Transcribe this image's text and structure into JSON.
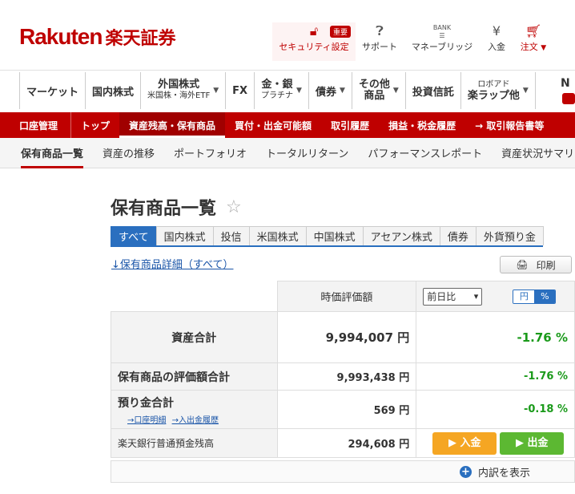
{
  "brand": {
    "logo_en": "Rakuten",
    "logo_jp": "楽天証券",
    "color": "#bf0000"
  },
  "header": {
    "security": {
      "label": "セキュリティ設定",
      "badge": "重要",
      "icon": "lock-icon"
    },
    "support": {
      "label": "サポート",
      "icon": "support-icon"
    },
    "money_bridge": {
      "label": "マネーブリッジ",
      "icon": "bank-icon",
      "icon_text": "BANK"
    },
    "deposit": {
      "label": "入金",
      "icon": "yen-icon"
    },
    "order": {
      "label": "注文",
      "icon": "cart-icon"
    }
  },
  "main_nav": {
    "items": [
      {
        "label": "マーケット"
      },
      {
        "label": "国内株式"
      },
      {
        "label": "外国株式",
        "sub": "米国株・海外ETF",
        "caret": "▼"
      },
      {
        "label": "FX"
      },
      {
        "label": "金・銀",
        "sub": "プラチナ",
        "caret": "▼"
      },
      {
        "label": "債券",
        "caret": "▼"
      },
      {
        "label": "その他",
        "sub": "商品",
        "caret": "▼"
      },
      {
        "label": "投資信託"
      },
      {
        "label": "ロボアド",
        "sub": "楽ラップ他",
        "caret": "▼"
      }
    ],
    "cut_label": "N"
  },
  "red_nav": {
    "items": [
      "口座管理",
      "トップ",
      "資産残高・保有商品",
      "買付・出金可能額",
      "取引履歴",
      "損益・税金履歴",
      "→ 取引報告書等"
    ]
  },
  "sub_nav": {
    "items": [
      "保有商品一覧",
      "資産の推移",
      "ポートフォリオ",
      "トータルリターン",
      "パフォーマンスレポート",
      "資産状況サマリ"
    ]
  },
  "page": {
    "title": "保有商品一覧"
  },
  "category_tabs": [
    "すべて",
    "国内株式",
    "投信",
    "米国株式",
    "中国株式",
    "アセアン株式",
    "債券",
    "外貨預り金"
  ],
  "detail_link": "↓保有商品詳細（すべて）",
  "print_label": "印刷",
  "table": {
    "col_header": "時価評価額",
    "compare_select": "前日比",
    "toggle": {
      "yen": "円",
      "pct": "%"
    },
    "rows": {
      "total": {
        "label": "資産合計",
        "value": "9,994,007 円",
        "change": "-1.76 %"
      },
      "holdings": {
        "label": "保有商品の評価額合計",
        "value": "9,993,438 円",
        "change": "-1.76 %"
      },
      "cash": {
        "label": "預り金合計",
        "value": "569 円",
        "change": "-0.18 %",
        "link1": "→口座明細",
        "link2": "→入出金履歴"
      },
      "bank": {
        "label": "楽天銀行普通預金残高",
        "value": "294,608 円",
        "deposit_btn": "▶ 入金",
        "withdraw_btn": "▶ 出金"
      }
    }
  },
  "breakdown_label": "内訳を表示",
  "colors": {
    "accent": "#bf0000",
    "tab_blue": "#2a6fbf",
    "positive": "#1a9a1a",
    "deposit": "#f5a623",
    "withdraw": "#5cb832"
  }
}
